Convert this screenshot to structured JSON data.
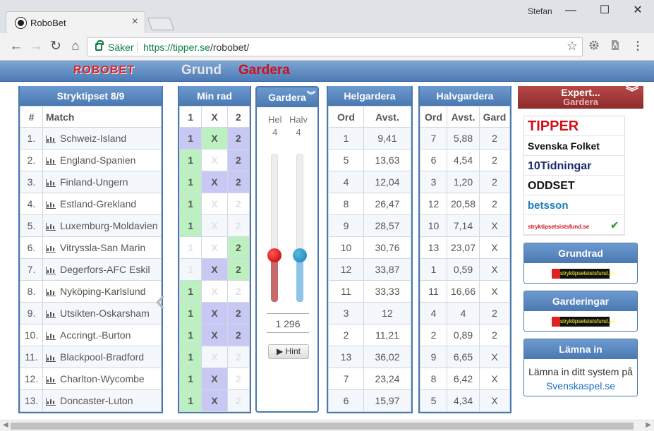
{
  "window": {
    "user": "Stefan",
    "minimize": "—",
    "maximize": "☐",
    "close": "✕"
  },
  "tab": {
    "title": "RoboBet",
    "close": "×"
  },
  "toolbar": {
    "back": "←",
    "forward": "→",
    "reload": "↻",
    "home": "⌂",
    "secure_label": "Säker",
    "url_prefix": "https://tipper.se",
    "url_path": "/robobet/",
    "star": "☆",
    "menu": "⋮"
  },
  "appbar": {
    "logo": "ROBOBET",
    "nav": [
      {
        "label": "Grund",
        "color": "#e6e6e6"
      },
      {
        "label": "Gardera",
        "color": "#d0101a"
      }
    ]
  },
  "stryk": {
    "title": "Stryktipset 8/9",
    "col_num": "#",
    "col_match": "Match"
  },
  "minrad": {
    "title": "Min rad",
    "cols": [
      "1",
      "X",
      "2"
    ]
  },
  "helg": {
    "title": "Helgardera",
    "cols": [
      "Ord",
      "Avst."
    ]
  },
  "halv": {
    "title": "Halvgardera",
    "cols": [
      "Ord",
      "Avst.",
      "Gard"
    ]
  },
  "rows": [
    {
      "n": "1.",
      "match": "Schweiz-Island",
      "p": [
        "1",
        "X",
        "2"
      ],
      "s": [
        "a",
        "b",
        "a"
      ],
      "ho": "1",
      "ha": "9,41",
      "vo": "7",
      "va": "5,88",
      "vg": "2"
    },
    {
      "n": "2.",
      "match": "England-Spanien",
      "p": [
        "1",
        "X",
        "2"
      ],
      "s": [
        "b",
        "u",
        "a"
      ],
      "ho": "5",
      "ha": "13,63",
      "vo": "6",
      "va": "4,54",
      "vg": "2"
    },
    {
      "n": "3.",
      "match": "Finland-Ungern",
      "p": [
        "1",
        "X",
        "2"
      ],
      "s": [
        "b",
        "a",
        "a"
      ],
      "ho": "4",
      "ha": "12,04",
      "vo": "3",
      "va": "1,20",
      "vg": "2"
    },
    {
      "n": "4.",
      "match": "Estland-Grekland",
      "p": [
        "1",
        "X",
        "2"
      ],
      "s": [
        "b",
        "u",
        "u"
      ],
      "ho": "8",
      "ha": "26,47",
      "vo": "12",
      "va": "20,58",
      "vg": "2"
    },
    {
      "n": "5.",
      "match": "Luxemburg-Moldavien",
      "p": [
        "1",
        "X",
        "2"
      ],
      "s": [
        "b",
        "u",
        "u"
      ],
      "ho": "9",
      "ha": "28,57",
      "vo": "10",
      "va": "7,14",
      "vg": "X"
    },
    {
      "n": "6.",
      "match": "Vitryssla-San Marin",
      "p": [
        "1",
        "X",
        "2"
      ],
      "s": [
        "u",
        "u",
        "b"
      ],
      "ho": "10",
      "ha": "30,76",
      "vo": "13",
      "va": "23,07",
      "vg": "X"
    },
    {
      "n": "7.",
      "match": "Degerfors-AFC Eskil",
      "p": [
        "1",
        "X",
        "2"
      ],
      "s": [
        "u",
        "a",
        "b"
      ],
      "ho": "12",
      "ha": "33,87",
      "vo": "1",
      "va": "0,59",
      "vg": "X"
    },
    {
      "n": "8.",
      "match": "Nyköping-Karlslund",
      "p": [
        "1",
        "X",
        "2"
      ],
      "s": [
        "b",
        "u",
        "u"
      ],
      "ho": "11",
      "ha": "33,33",
      "vo": "11",
      "va": "16,66",
      "vg": "X"
    },
    {
      "n": "9.",
      "match": "Utsikten-Oskarsham",
      "p": [
        "1",
        "X",
        "2"
      ],
      "s": [
        "b",
        "a",
        "a"
      ],
      "ho": "3",
      "ha": "12",
      "vo": "4",
      "va": "4",
      "vg": "2"
    },
    {
      "n": "10.",
      "match": "Accringt.-Burton",
      "p": [
        "1",
        "X",
        "2"
      ],
      "s": [
        "b",
        "a",
        "a"
      ],
      "ho": "2",
      "ha": "11,21",
      "vo": "2",
      "va": "0,89",
      "vg": "2"
    },
    {
      "n": "11.",
      "match": "Blackpool-Bradford",
      "p": [
        "1",
        "X",
        "2"
      ],
      "s": [
        "b",
        "u",
        "u"
      ],
      "ho": "13",
      "ha": "36,02",
      "vo": "9",
      "va": "6,65",
      "vg": "X"
    },
    {
      "n": "12.",
      "match": "Charlton-Wycombe",
      "p": [
        "1",
        "X",
        "2"
      ],
      "s": [
        "b",
        "a",
        "u"
      ],
      "ho": "7",
      "ha": "23,24",
      "vo": "8",
      "va": "6,42",
      "vg": "X"
    },
    {
      "n": "13.",
      "match": "Doncaster-Luton",
      "p": [
        "1",
        "X",
        "2"
      ],
      "s": [
        "b",
        "a",
        "u"
      ],
      "ho": "6",
      "ha": "15,97",
      "vo": "5",
      "va": "4,34",
      "vg": "X"
    }
  ],
  "gardera": {
    "title": "Gardera",
    "hel_label": "Hel",
    "halv_label": "Halv",
    "hel_value": "4",
    "halv_value": "4",
    "hel_fraction": 0.31,
    "halv_fraction": 0.31,
    "total": "1 296",
    "hint": "▶ Hint"
  },
  "expert": {
    "title": "Expert...",
    "subtitle": "Gardera"
  },
  "brands": [
    {
      "label": "TIPPER",
      "color": "#d0101a",
      "size": "20px"
    },
    {
      "label": "Svenska Folket",
      "color": "#111111",
      "size": "14px"
    },
    {
      "label": "10Tidningar",
      "color": "#1a2a6e",
      "size": "16px"
    },
    {
      "label": "ODDSET",
      "color": "#111111",
      "size": "16px"
    },
    {
      "label": "betsson",
      "color": "#1b7fb8",
      "size": "15px"
    },
    {
      "label": "stryktipsetsistsfund.se",
      "color": "#d0101a",
      "size": "8px"
    }
  ],
  "boxes": {
    "grundrad": "Grundrad",
    "garderingar": "Garderingar",
    "lamna_title": "Lämna in",
    "lamna_text": "Lämna in ditt system på",
    "lamna_link": "Svenskaspel.se",
    "mini_logo": "stryktipsetsistsfund.se"
  }
}
